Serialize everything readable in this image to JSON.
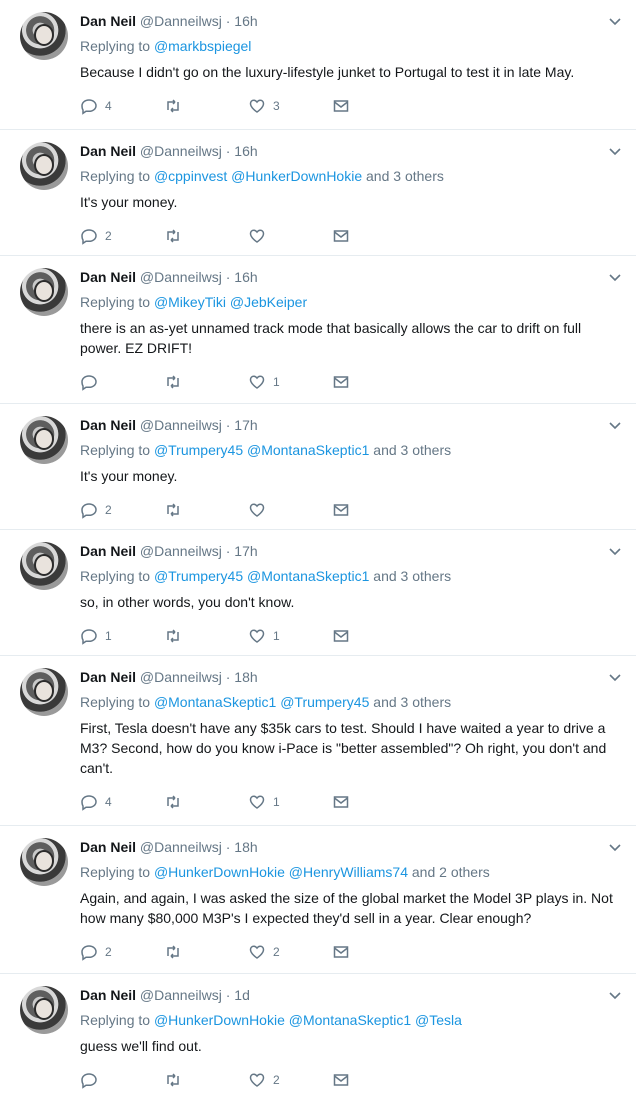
{
  "tweets": [
    {
      "name": "Dan Neil",
      "handle": "@Danneilwsj",
      "time": "16h",
      "replying_prefix": "Replying to",
      "mentions": "@markbspiegel",
      "others": "",
      "text": "Because I didn't go on the luxury-lifestyle junket to Portugal to test it in late May.",
      "reply_count": "4",
      "retweet_count": "",
      "like_count": "3"
    },
    {
      "name": "Dan Neil",
      "handle": "@Danneilwsj",
      "time": "16h",
      "replying_prefix": "Replying to",
      "mentions": "@cppinvest @HunkerDownHokie",
      "others": "and 3 others",
      "text": "It's your money.",
      "reply_count": "2",
      "retweet_count": "",
      "like_count": ""
    },
    {
      "name": "Dan Neil",
      "handle": "@Danneilwsj",
      "time": "16h",
      "replying_prefix": "Replying to",
      "mentions": "@MikeyTiki @JebKeiper",
      "others": "",
      "text": "there is an as-yet unnamed track mode that basically allows the car to drift on full power. EZ DRIFT!",
      "reply_count": "",
      "retweet_count": "",
      "like_count": "1"
    },
    {
      "name": "Dan Neil",
      "handle": "@Danneilwsj",
      "time": "17h",
      "replying_prefix": "Replying to",
      "mentions": "@Trumpery45 @MontanaSkeptic1",
      "others": "and 3 others",
      "text": "It's your money.",
      "reply_count": "2",
      "retweet_count": "",
      "like_count": ""
    },
    {
      "name": "Dan Neil",
      "handle": "@Danneilwsj",
      "time": "17h",
      "replying_prefix": "Replying to",
      "mentions": "@Trumpery45 @MontanaSkeptic1",
      "others": "and 3 others",
      "text": "so, in other words, you don't know.",
      "reply_count": "1",
      "retweet_count": "",
      "like_count": "1"
    },
    {
      "name": "Dan Neil",
      "handle": "@Danneilwsj",
      "time": "18h",
      "replying_prefix": "Replying to",
      "mentions": "@MontanaSkeptic1 @Trumpery45",
      "others": "and 3 others",
      "text": "First, Tesla doesn't have any $35k cars to test. Should I have waited a year to drive a M3? Second, how do you know i-Pace is \"better assembled\"? Oh right, you don't and can't.",
      "reply_count": "4",
      "retweet_count": "",
      "like_count": "1"
    },
    {
      "name": "Dan Neil",
      "handle": "@Danneilwsj",
      "time": "18h",
      "replying_prefix": "Replying to",
      "mentions": "@HunkerDownHokie @HenryWilliams74",
      "others": "and 2 others",
      "text": "Again, and again, I was asked the size of the global market the Model 3P plays in. Not how many $80,000 M3P's I expected they'd sell in a year. Clear enough?",
      "reply_count": "2",
      "retweet_count": "",
      "like_count": "2"
    },
    {
      "name": "Dan Neil",
      "handle": "@Danneilwsj",
      "time": "1d",
      "replying_prefix": "Replying to",
      "mentions": "@HunkerDownHokie @MontanaSkeptic1 @Tesla",
      "others": "",
      "text": "guess we'll find out.",
      "reply_count": "",
      "retweet_count": "",
      "like_count": "2"
    }
  ],
  "icons": {
    "chevron": "chevron-down-icon",
    "reply": "reply-icon",
    "retweet": "retweet-icon",
    "like": "heart-icon",
    "dm": "envelope-icon"
  },
  "colors": {
    "link": "#1b95e0",
    "muted": "#657786",
    "text": "#14171a",
    "border": "#e6ecf0"
  }
}
